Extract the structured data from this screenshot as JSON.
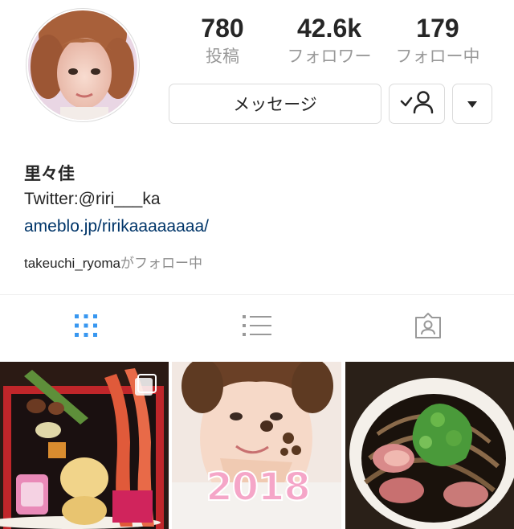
{
  "profile": {
    "avatar_icon": "profile-photo",
    "name": "里々佳",
    "bio": "Twitter:@riri___ka",
    "link": "ameblo.jp/ririkaaaaaaaa/",
    "followed_by_user": "takeuchi_ryoma",
    "followed_by_suffix": "がフォロー中"
  },
  "stats": [
    {
      "count": "780",
      "label": "投稿"
    },
    {
      "count": "42.6k",
      "label": "フォロワー"
    },
    {
      "count": "179",
      "label": "フォロー中"
    }
  ],
  "actions": {
    "message_label": "メッセージ",
    "follow_icon": "following-check-person-icon",
    "more_icon": "caret-down-icon"
  },
  "tabs": [
    {
      "icon": "grid-icon",
      "active": true
    },
    {
      "icon": "list-icon",
      "active": false
    },
    {
      "icon": "tagged-icon",
      "active": false
    }
  ],
  "posts": [
    {
      "image": "osechi-bento-with-shrimp",
      "multi": true
    },
    {
      "image": "selfie-with-dog-ears-and-2018-sticker",
      "multi": false,
      "sticker_text": "2018"
    },
    {
      "image": "soba-noodles-with-duck-and-greens",
      "multi": false
    }
  ],
  "colors": {
    "link": "#003569",
    "active_tab": "#3897f0",
    "muted": "#999999",
    "border": "#dbdbdb"
  }
}
